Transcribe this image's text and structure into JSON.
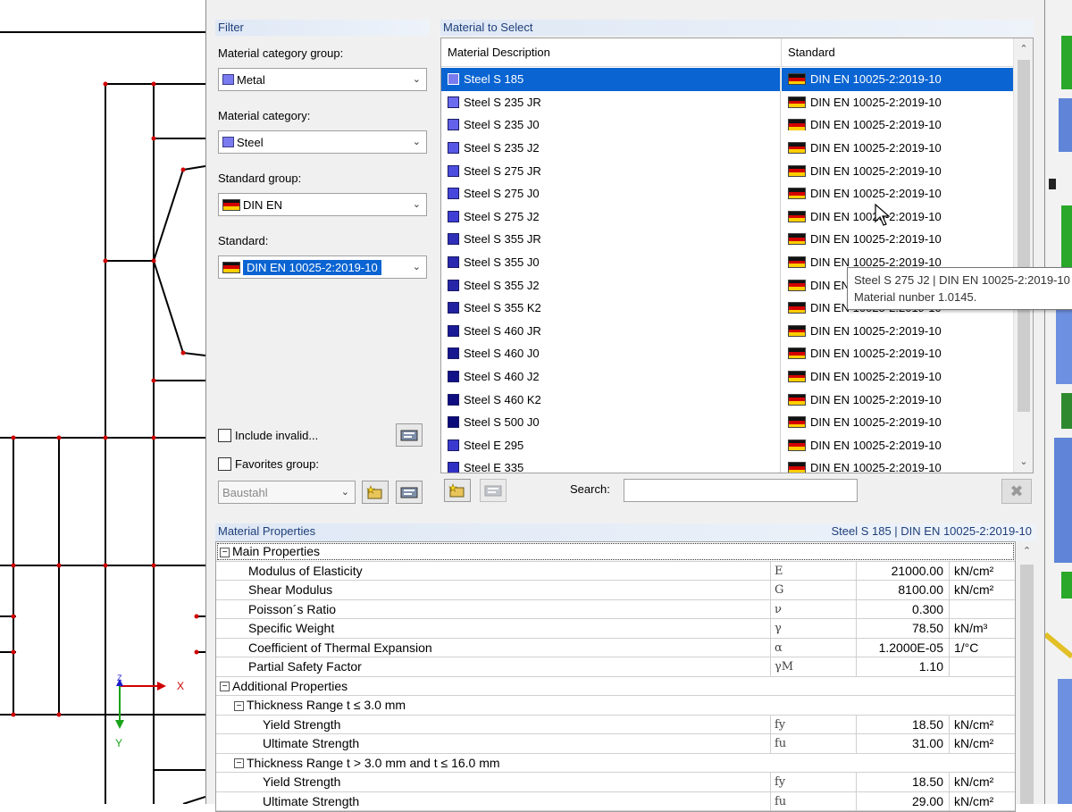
{
  "filter": {
    "title": "Filter",
    "category_group_label": "Material category group:",
    "category_group_value": "Metal",
    "category_label": "Material category:",
    "category_value": "Steel",
    "standard_group_label": "Standard group:",
    "standard_group_value": "DIN EN",
    "standard_label": "Standard:",
    "standard_value": "DIN EN 10025-2:2019-10",
    "include_invalid_label": "Include invalid...",
    "favorites_label": "Favorites group:",
    "favorites_value": "Baustahl"
  },
  "materials": {
    "title": "Material to Select",
    "col_description": "Material Description",
    "col_standard": "Standard",
    "rows": [
      {
        "name": "Steel S 185",
        "standard": "DIN EN 10025-2:2019-10",
        "color": "#7b7bf0"
      },
      {
        "name": "Steel S 235 JR",
        "standard": "DIN EN 10025-2:2019-10",
        "color": "#6b6bf0"
      },
      {
        "name": "Steel S 235 J0",
        "standard": "DIN EN 10025-2:2019-10",
        "color": "#6262ea"
      },
      {
        "name": "Steel S 235 J2",
        "standard": "DIN EN 10025-2:2019-10",
        "color": "#5858e6"
      },
      {
        "name": "Steel S 275 JR",
        "standard": "DIN EN 10025-2:2019-10",
        "color": "#4d4de0"
      },
      {
        "name": "Steel S 275 J0",
        "standard": "DIN EN 10025-2:2019-10",
        "color": "#4646dc"
      },
      {
        "name": "Steel S 275 J2",
        "standard": "DIN EN 10025-2:2019-10",
        "color": "#3f3fd6"
      },
      {
        "name": "Steel S 355 JR",
        "standard": "DIN EN 10025-2:2019-10",
        "color": "#2f2fb8"
      },
      {
        "name": "Steel S 355 J0",
        "standard": "DIN EN 10025-2:2019-10",
        "color": "#2a2ab0"
      },
      {
        "name": "Steel S 355 J2",
        "standard": "DIN EN 10025-2:2019-10",
        "color": "#2626a8"
      },
      {
        "name": "Steel S 355 K2",
        "standard": "DIN EN 10025-2:2019-10",
        "color": "#2222a0"
      },
      {
        "name": "Steel S 460 JR",
        "standard": "DIN EN 10025-2:2019-10",
        "color": "#1a1a96"
      },
      {
        "name": "Steel S 460 J0",
        "standard": "DIN EN 10025-2:2019-10",
        "color": "#16168e"
      },
      {
        "name": "Steel S 460 J2",
        "standard": "DIN EN 10025-2:2019-10",
        "color": "#121288"
      },
      {
        "name": "Steel S 460 K2",
        "standard": "DIN EN 10025-2:2019-10",
        "color": "#0e0e80"
      },
      {
        "name": "Steel S 500 J0",
        "standard": "DIN EN 10025-2:2019-10",
        "color": "#0a0a78"
      },
      {
        "name": "Steel E 295",
        "standard": "DIN EN 10025-2:2019-10",
        "color": "#3a3ad0"
      },
      {
        "name": "Steel E 335",
        "standard": "DIN EN 10025-2:2019-10",
        "color": "#3030c4"
      }
    ],
    "tooltip_line1": "Steel S 275 J2 | DIN EN 10025-2:2019-10",
    "tooltip_line2": "Material nunber 1.0145.",
    "search_label": "Search:",
    "search_value": ""
  },
  "properties": {
    "title": "Material Properties",
    "selected": "Steel S 185  |  DIN EN 10025-2:2019-10",
    "rows": [
      {
        "type": "section",
        "indent": 0,
        "name": "Main Properties"
      },
      {
        "type": "prop",
        "indent": 1,
        "name": "Modulus of Elasticity",
        "symbol": "E",
        "value": "21000.00",
        "unit": "kN/cm²"
      },
      {
        "type": "prop",
        "indent": 1,
        "name": "Shear Modulus",
        "symbol": "G",
        "value": "8100.00",
        "unit": "kN/cm²"
      },
      {
        "type": "prop",
        "indent": 1,
        "name": "Poisson´s Ratio",
        "symbol": "ν",
        "value": "0.300",
        "unit": ""
      },
      {
        "type": "prop",
        "indent": 1,
        "name": "Specific Weight",
        "symbol": "γ",
        "value": "78.50",
        "unit": "kN/m³"
      },
      {
        "type": "prop",
        "indent": 1,
        "name": "Coefficient of Thermal Expansion",
        "symbol": "α",
        "value": "1.2000E-05",
        "unit": "1/°C"
      },
      {
        "type": "prop",
        "indent": 1,
        "name": "Partial Safety Factor",
        "symbol": "γM",
        "value": "1.10",
        "unit": ""
      },
      {
        "type": "section",
        "indent": 0,
        "name": "Additional Properties"
      },
      {
        "type": "section",
        "indent": 1,
        "name": "Thickness Range t ≤ 3.0 mm"
      },
      {
        "type": "prop",
        "indent": 2,
        "name": "Yield Strength",
        "symbol": "fy",
        "value": "18.50",
        "unit": "kN/cm²"
      },
      {
        "type": "prop",
        "indent": 2,
        "name": "Ultimate Strength",
        "symbol": "fu",
        "value": "31.00",
        "unit": "kN/cm²"
      },
      {
        "type": "section",
        "indent": 1,
        "name": "Thickness Range t > 3.0 mm and t ≤ 16.0 mm"
      },
      {
        "type": "prop",
        "indent": 2,
        "name": "Yield Strength",
        "symbol": "fy",
        "value": "18.50",
        "unit": "kN/cm²"
      },
      {
        "type": "prop",
        "indent": 2,
        "name": "Ultimate Strength",
        "symbol": "fu",
        "value": "29.00",
        "unit": "kN/cm²"
      }
    ]
  },
  "drawing": {
    "axis_x": "X",
    "axis_y": "Y",
    "axis_z": "Z"
  },
  "colors": {
    "selection": "#0a64d2",
    "title_blue": "#1e3f7a"
  },
  "icons": [
    "dropdown-arrow-icon",
    "german-flag-icon",
    "material-library-icon",
    "new-favorite-icon",
    "clear-filter-icon",
    "mouse-cursor-icon"
  ]
}
